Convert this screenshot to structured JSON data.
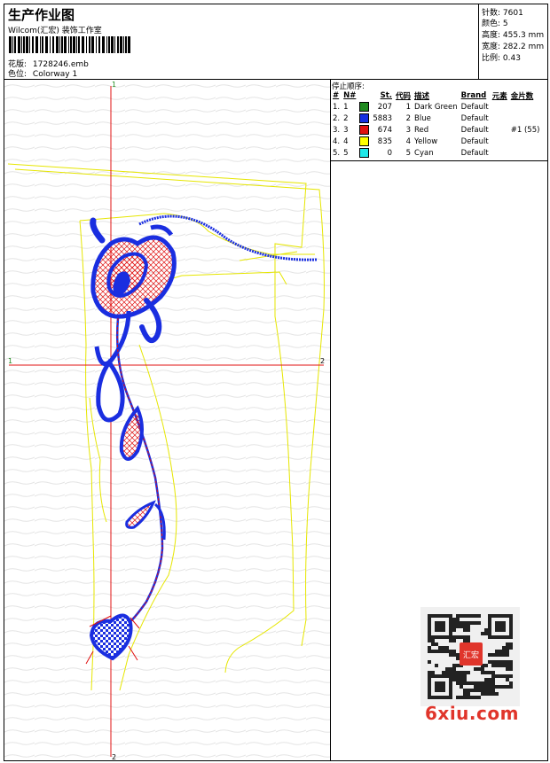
{
  "header": {
    "title": "生产作业图",
    "company": "Wilcom(汇宏) 装饰工作室",
    "file_label": "花版:",
    "file_name": "1728246.emb",
    "colorway_label": "色位:",
    "colorway_name": "Colorway 1"
  },
  "stats": {
    "stitches_label": "针数:",
    "stitches": "7601",
    "colors_label": "颜色:",
    "colors": "5",
    "height_label": "高度:",
    "height": "455.3 mm",
    "width_label": "宽度:",
    "width": "282.2 mm",
    "scale_label": "比例:",
    "scale": "0.43"
  },
  "sequence": {
    "title": "停止顺序:",
    "columns": [
      "#",
      "N#",
      "St.",
      "代码",
      "描述",
      "Brand",
      "元素",
      "金片数"
    ],
    "rows": [
      {
        "n": "1.",
        "nn": "1",
        "color": "#1f8a1f",
        "st": "207",
        "code": "1",
        "desc": "Dark Green",
        "brand": "Default",
        "elem": "",
        "seq": ""
      },
      {
        "n": "2.",
        "nn": "2",
        "color": "#1530e0",
        "st": "5883",
        "code": "2",
        "desc": "Blue",
        "brand": "Default",
        "elem": "",
        "seq": ""
      },
      {
        "n": "3.",
        "nn": "3",
        "color": "#e01010",
        "st": "674",
        "code": "3",
        "desc": "Red",
        "brand": "Default",
        "elem": "",
        "seq": "#1 (55)"
      },
      {
        "n": "4.",
        "nn": "4",
        "color": "#ffff00",
        "st": "835",
        "code": "4",
        "desc": "Yellow",
        "brand": "Default",
        "elem": "",
        "seq": ""
      },
      {
        "n": "5.",
        "nn": "5",
        "color": "#20e8e8",
        "st": "0",
        "code": "5",
        "desc": "Cyan",
        "brand": "Default",
        "elem": "",
        "seq": ""
      }
    ]
  },
  "design": {
    "axis_top": "1",
    "axis_bottom": "2",
    "axis_left": "1",
    "axis_right": "2",
    "axis_color": "#e01010",
    "outline_color": "#e6e600",
    "thread_blue": "#1a2ee0",
    "thread_red": "#e01010"
  },
  "watermark": {
    "logo_text": "6xiu.com",
    "stamp_text": "汇宏"
  }
}
